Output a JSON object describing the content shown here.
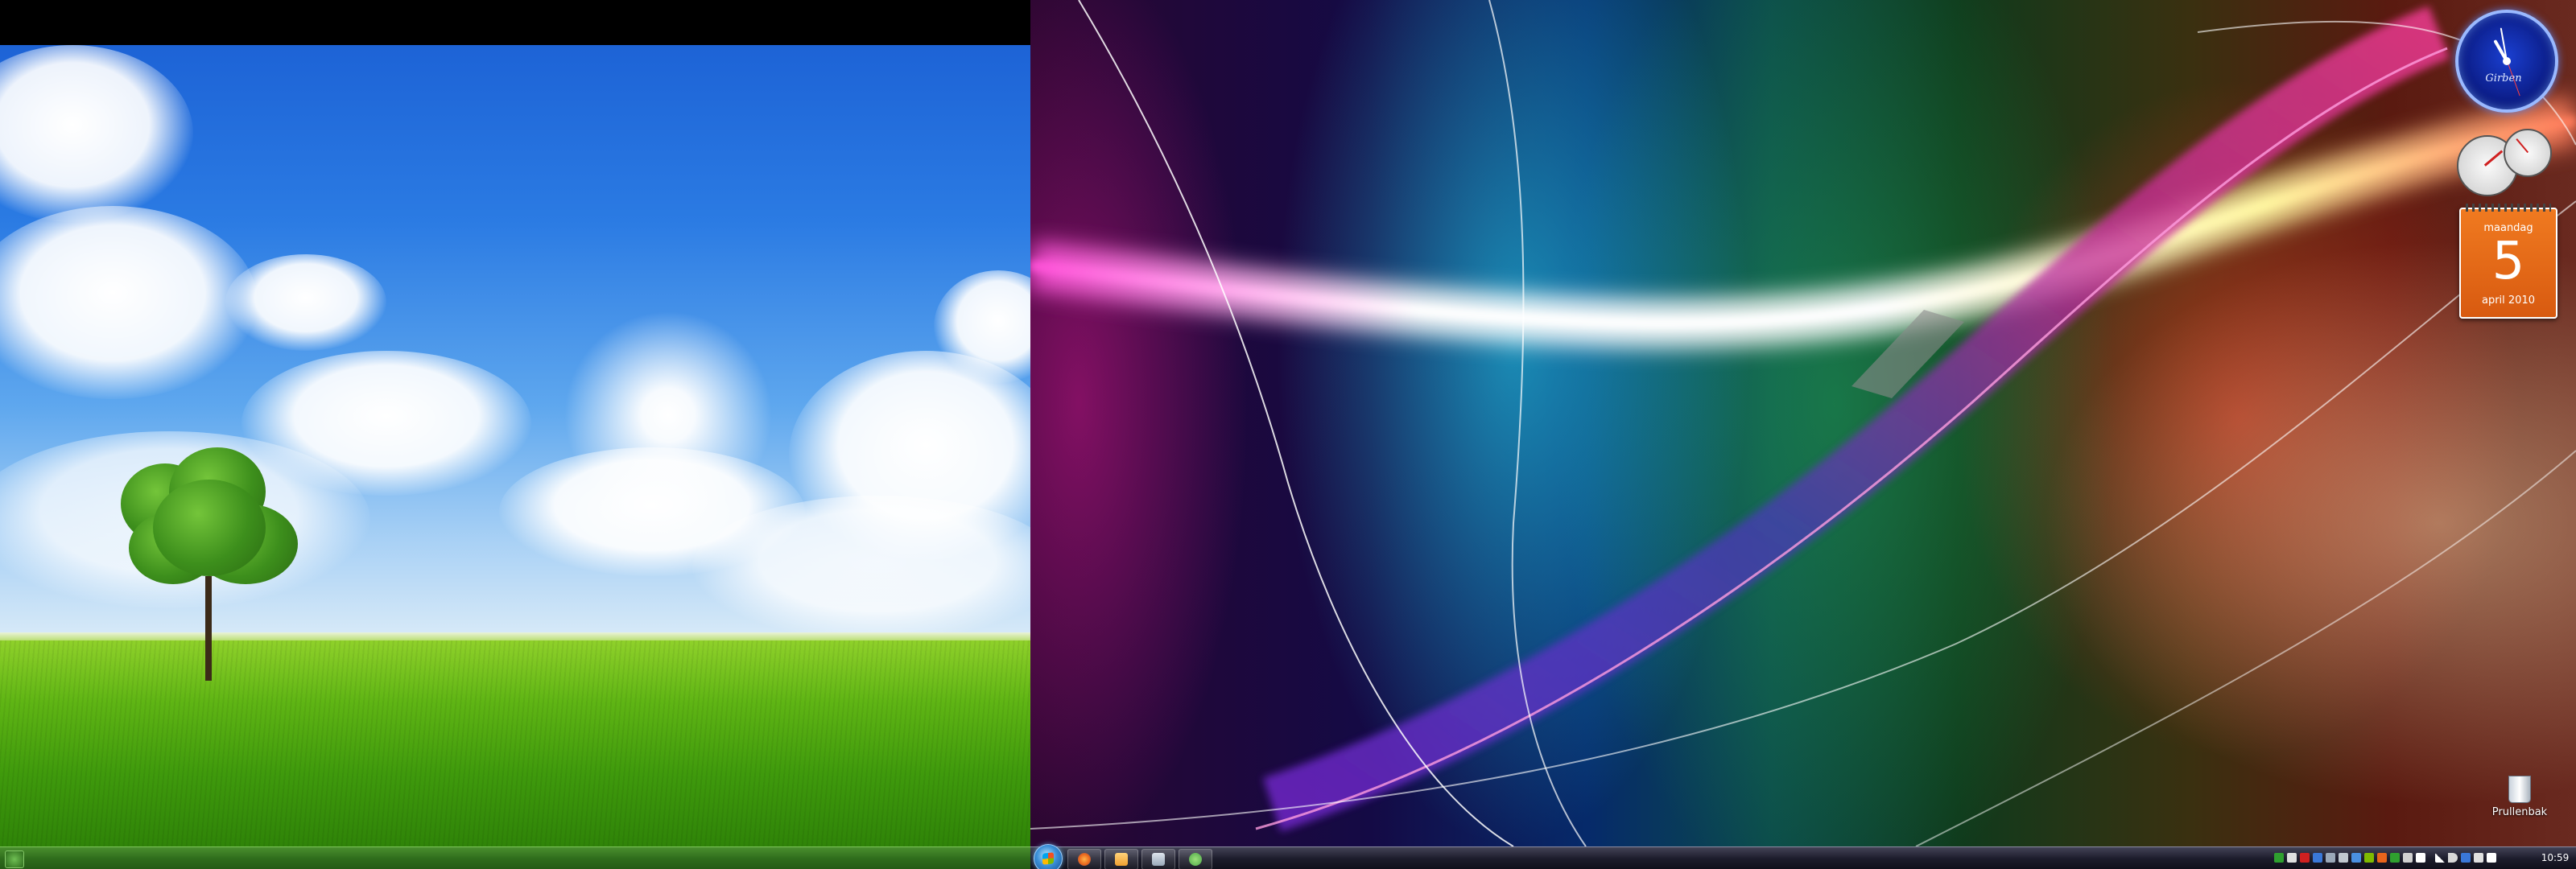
{
  "left_monitor": {
    "wallpaper": "tree-on-meadow",
    "colors": {
      "sky": "#2b7be3",
      "grass": "#5fb514",
      "taskbar": "#2f6d1c"
    }
  },
  "right_monitor": {
    "wallpaper": "abstract-light-waves",
    "gadgets": {
      "clock": {
        "label": "Girben"
      },
      "calendar": {
        "weekday": "maandag",
        "day": "5",
        "month_year": "april 2010"
      },
      "cpu_meter": {
        "value_label": ""
      }
    },
    "desktop_icons": [
      {
        "label": "Prullenbak",
        "icon": "recycle-bin-icon"
      }
    ],
    "taskbar": {
      "start_button": "start-orb",
      "pinned": [
        {
          "name": "firefox",
          "icon": "firefox-icon",
          "color": "#e8641b"
        },
        {
          "name": "media-player",
          "icon": "media-player-icon",
          "color": "#f0a030"
        },
        {
          "name": "pin-app",
          "icon": "pin-icon",
          "color": "#9aa8b8"
        },
        {
          "name": "messenger",
          "icon": "messenger-icon",
          "color": "#4fa84a"
        }
      ],
      "clock": "10:59"
    }
  }
}
